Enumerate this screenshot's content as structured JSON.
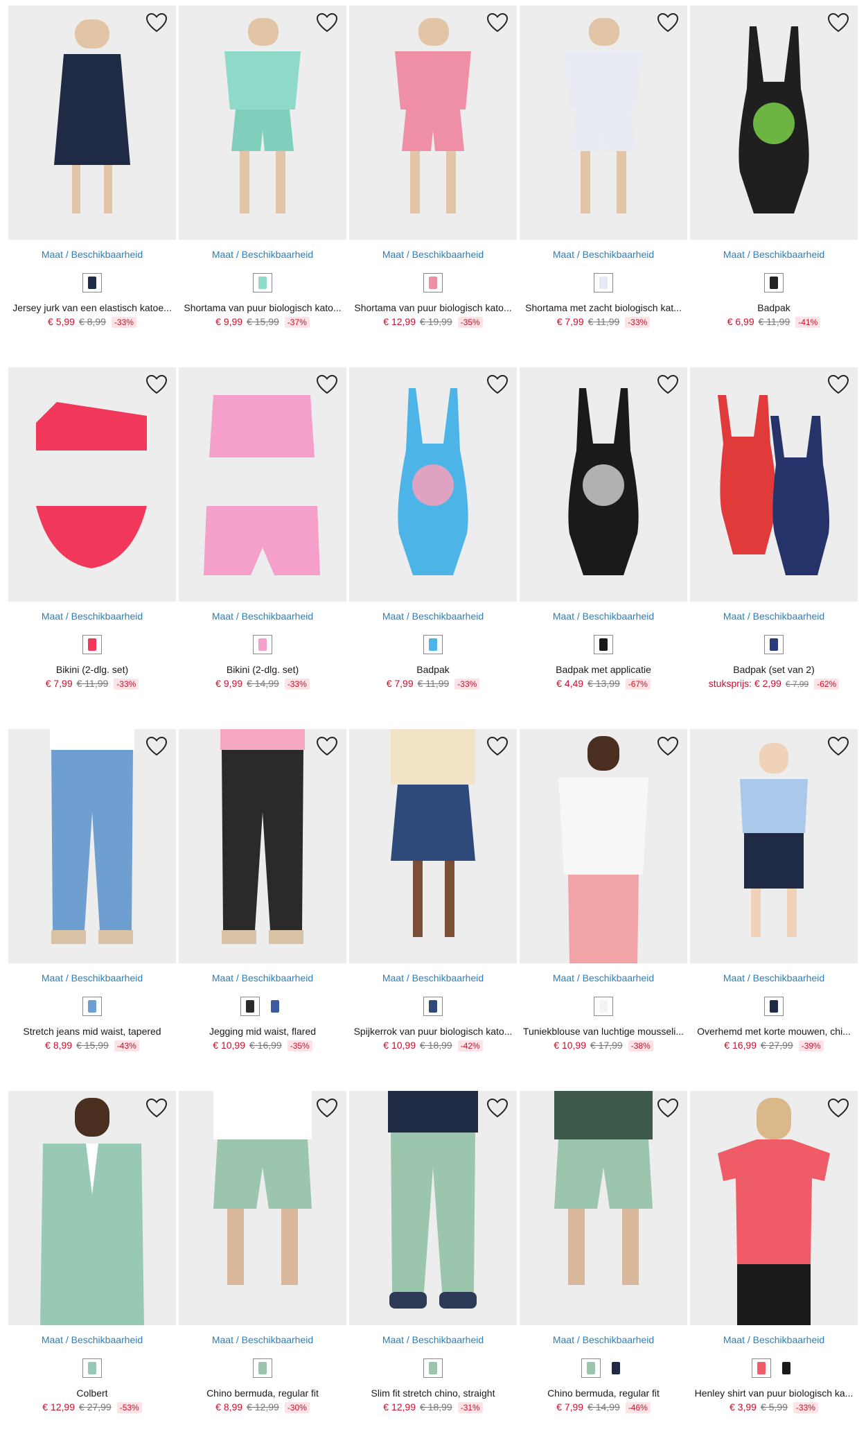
{
  "maat_label": "Maat / Beschikbaarheid",
  "products": [
    {
      "name": "Jersey jurk van een elastisch katoe...",
      "price": "€ 5,99",
      "old": "€ 8,99",
      "disc": "-33%",
      "bg": "#ededed",
      "swatches": [
        "#1f2a44"
      ],
      "icon": "dress",
      "c1": "#1f2a44",
      "c2": "#1f2a44"
    },
    {
      "name": "Shortama van puur biologisch kato...",
      "price": "€ 9,99",
      "old": "€ 15,99",
      "disc": "-37%",
      "bg": "#ededed",
      "swatches": [
        "#8fd9c8"
      ],
      "icon": "set",
      "c1": "#8fd9c8",
      "c2": "#7fcfbc"
    },
    {
      "name": "Shortama van puur biologisch kato...",
      "price": "€ 12,99",
      "old": "€ 19,99",
      "disc": "-35%",
      "bg": "#ededed",
      "swatches": [
        "#ef8fa5"
      ],
      "icon": "set",
      "c1": "#ef8fa5",
      "c2": "#ef8fa5"
    },
    {
      "name": "Shortama met zacht biologisch kat...",
      "price": "€ 7,99",
      "old": "€ 11,99",
      "disc": "-33%",
      "bg": "#ededed",
      "swatches": [
        "#e6e8f2"
      ],
      "icon": "set",
      "c1": "#e8eaf4",
      "c2": "#e8eaf4"
    },
    {
      "name": "Badpak",
      "price": "€ 6,99",
      "old": "€ 11,99",
      "disc": "-41%",
      "bg": "#ededed",
      "swatches": [
        "#222222"
      ],
      "icon": "swim",
      "c1": "#1f1f1f",
      "c2": "#7ad04a"
    },
    {
      "name": "Bikini (2-dlg. set)",
      "price": "€ 7,99",
      "old": "€ 11,99",
      "disc": "-33%",
      "bg": "#ededed",
      "swatches": [
        "#f2385a"
      ],
      "icon": "bikini",
      "c1": "#f2385a",
      "c2": "#f2385a"
    },
    {
      "name": "Bikini (2-dlg. set)",
      "price": "€ 9,99",
      "old": "€ 14,99",
      "disc": "-33%",
      "bg": "#ededed",
      "swatches": [
        "#f59fcb"
      ],
      "icon": "bikini2",
      "c1": "#f59fcb",
      "c2": "#f59fcb"
    },
    {
      "name": "Badpak",
      "price": "€ 7,99",
      "old": "€ 11,99",
      "disc": "-33%",
      "bg": "#ededed",
      "swatches": [
        "#4db4e8"
      ],
      "icon": "swim",
      "c1": "#4db4e8",
      "c2": "#f7a0b8"
    },
    {
      "name": "Badpak met applicatie",
      "price": "€ 4,49",
      "old": "€ 13,99",
      "disc": "-67%",
      "bg": "#ededed",
      "swatches": [
        "#1a1a1a"
      ],
      "icon": "swim",
      "c1": "#1a1a1a",
      "c2": "#cccccc"
    },
    {
      "name": "Badpak (set van 2)",
      "prefix": "stuksprijs: ",
      "price": "€ 2,99",
      "old": "€ 7,99",
      "old_small": true,
      "disc": "-62%",
      "bg": "#ededed",
      "swatches": [
        "#2b3a78"
      ],
      "icon": "swim2",
      "c1": "#e03a3a",
      "c2": "#26336b"
    },
    {
      "name": "Stretch jeans mid waist, tapered",
      "price": "€ 8,99",
      "old": "€ 15,99",
      "disc": "-43%",
      "bg": "#ededed",
      "swatches": [
        "#6f9fd0"
      ],
      "icon": "jeans",
      "c1": "#6f9fd0",
      "c2": "#ffffff"
    },
    {
      "name": "Jegging mid waist, flared",
      "price": "€ 10,99",
      "old": "€ 16,99",
      "disc": "-35%",
      "bg": "#ededed",
      "swatches": [
        "#2a2a2a",
        "#3b5aa0"
      ],
      "plain_second": true,
      "icon": "jeans",
      "c1": "#2a2a2a",
      "c2": "#f5a6c3"
    },
    {
      "name": "Spijkerrok van puur biologisch kato...",
      "price": "€ 10,99",
      "old": "€ 18,99",
      "disc": "-42%",
      "bg": "#ededed",
      "swatches": [
        "#2e4a7a"
      ],
      "icon": "skirt",
      "c1": "#2e4a7a",
      "c2": "#f1e4c6"
    },
    {
      "name": "Tuniekblouse van luchtige mousseli...",
      "price": "€ 10,99",
      "old": "€ 17,99",
      "disc": "-38%",
      "bg": "#ededed",
      "swatches": [
        "#f4f4f4"
      ],
      "icon": "blouse",
      "c1": "#f7f7f7",
      "c2": "#f1a3a8"
    },
    {
      "name": "Overhemd met korte mouwen, chi...",
      "price": "€ 16,99",
      "old": "€ 27,99",
      "disc": "-39%",
      "bg": "#ededed",
      "swatches": [
        "#1f2a44"
      ],
      "icon": "shirt",
      "c1": "#a9c8ea",
      "c2": "#1f2a44"
    },
    {
      "name": "Colbert",
      "price": "€ 12,99",
      "old": "€ 27,99",
      "disc": "-53%",
      "bg": "#ededed",
      "swatches": [
        "#97c9b4"
      ],
      "icon": "blazer",
      "c1": "#97c9b4",
      "c2": "#97c9b4"
    },
    {
      "name": "Chino bermuda, regular fit",
      "price": "€ 8,99",
      "old": "€ 12,99",
      "disc": "-30%",
      "bg": "#ededed",
      "swatches": [
        "#9cc5ad"
      ],
      "icon": "shorts",
      "c1": "#9cc5ad",
      "c2": "#ffffff"
    },
    {
      "name": "Slim fit stretch chino, straight",
      "price": "€ 12,99",
      "old": "€ 18,99",
      "disc": "-31%",
      "bg": "#ededed",
      "swatches": [
        "#9cc5ad"
      ],
      "icon": "pants",
      "c1": "#9cc5ad",
      "c2": "#1f2a44"
    },
    {
      "name": "Chino bermuda, regular fit",
      "price": "€ 7,99",
      "old": "€ 14,99",
      "disc": "-46%",
      "bg": "#ededed",
      "swatches": [
        "#9cc5ad",
        "#1f2a44"
      ],
      "plain_second": true,
      "icon": "shorts",
      "c1": "#9cc5ad",
      "c2": "#3e5a4a"
    },
    {
      "name": "Henley shirt van puur biologisch ka...",
      "price": "€ 3,99",
      "old": "€ 5,99",
      "disc": "-33%",
      "bg": "#ededed",
      "swatches": [
        "#ef5b66",
        "#1a1a1a"
      ],
      "plain_second": true,
      "icon": "tee",
      "c1": "#ef5b66",
      "c2": "#1a1a1a"
    }
  ]
}
